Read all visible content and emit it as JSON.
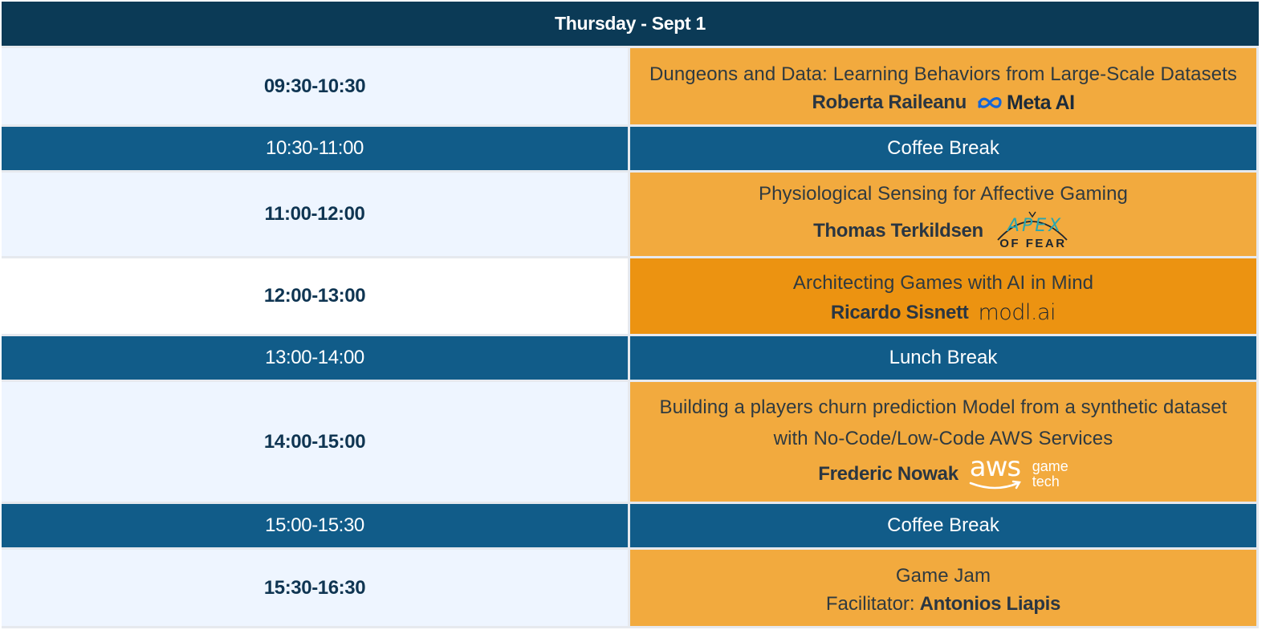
{
  "header": {
    "title": "Thursday - Sept 1"
  },
  "rows": [
    {
      "time": "09:30-10:30",
      "title": "Dungeons and Data: Learning Behaviors from Large-Scale Datasets",
      "speaker": "Roberta Raileanu",
      "logo": "meta-ai-logo",
      "logo_text": "Meta AI"
    },
    {
      "time": "10:30-11:00",
      "break": "Coffee Break"
    },
    {
      "time": "11:00-12:00",
      "title": "Physiological Sensing for Affective Gaming",
      "speaker": "Thomas Terkildsen",
      "logo": "apex-of-fear-logo",
      "logo_text_top": "APEX",
      "logo_text_bottom": "OF FEAR"
    },
    {
      "time": "12:00-13:00",
      "title": "Architecting Games with AI in Mind",
      "speaker": "Ricardo Sisnett",
      "logo": "modl-ai-logo",
      "logo_text": "modl.ai"
    },
    {
      "time": "13:00-14:00",
      "break": "Lunch Break"
    },
    {
      "time": "14:00-15:00",
      "title_line1": "Building a players churn prediction Model from a synthetic dataset",
      "title_line2": "with No-Code/Low-Code AWS Services",
      "speaker": "Frederic Nowak",
      "logo": "aws-gametech-logo",
      "logo_text": "aws",
      "logo_sub1": "game",
      "logo_sub2": "tech"
    },
    {
      "time": "15:00-15:30",
      "break": "Coffee Break"
    },
    {
      "time": "15:30-16:30",
      "title": "Game Jam",
      "facilitator_label": "Facilitator:",
      "speaker": "Antonios Liapis"
    }
  ],
  "colors": {
    "header": "#0b3a56",
    "break": "#115c89",
    "talk": "#f2aa3e",
    "talk_highlight": "#ec9311",
    "time_cell": "#eef5ff"
  }
}
